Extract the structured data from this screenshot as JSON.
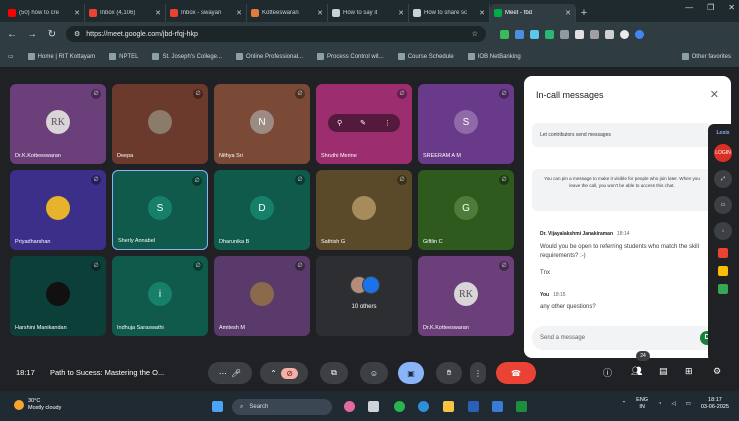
{
  "browser": {
    "tabs": [
      {
        "title": "(50) how to cre",
        "color": "#ff0000",
        "active": false
      },
      {
        "title": "Inbox (4,106)",
        "color": "#ea4335",
        "active": false
      },
      {
        "title": "Inbox - swayan",
        "color": "#ea4335",
        "active": false
      },
      {
        "title": "Kotteeswaran",
        "color": "#e07a3d",
        "active": false
      },
      {
        "title": "How to say it",
        "color": "#c9d1d3",
        "active": false
      },
      {
        "title": "How to share sc",
        "color": "#c9d1d3",
        "active": false
      },
      {
        "title": "Meet - fbd",
        "color": "#00ac47",
        "active": true
      }
    ],
    "url": "https://meet.google.com/jbd-rfqj-hkp",
    "bookmarks": [
      {
        "label": "Home | RIT Kottayam"
      },
      {
        "label": "NPTEL"
      },
      {
        "label": "St. Joseph's College..."
      },
      {
        "label": "Online Professional..."
      },
      {
        "label": "Process Control wit..."
      },
      {
        "label": "Course Schedule"
      },
      {
        "label": "IOB NetBanking"
      }
    ],
    "bookmarks_right": "Other favorites"
  },
  "participants": [
    {
      "name": "Dr.K.Kotteeswaran",
      "initial": "RK",
      "bg": "#6b3f7a",
      "avatar_bg": "#d8d4d8",
      "avatar_fg": "#555"
    },
    {
      "name": "Deepa",
      "initial": "",
      "bg": "#6b3a2c",
      "avatar_bg": "#8a7b6a",
      "avatar_fg": "#fff"
    },
    {
      "name": "Nithya Sri",
      "initial": "N",
      "bg": "#7a4a36",
      "avatar_bg": "#9c8b84",
      "avatar_fg": "#fff"
    },
    {
      "name": "Shruthi Merine",
      "initial": "",
      "bg": "#9c2e6f",
      "avatar_bg": "#9c2e6f",
      "avatar_fg": "#fff"
    },
    {
      "name": "SREERAM A M",
      "initial": "S",
      "bg": "#6a3a8a",
      "avatar_bg": "#8f6aa8",
      "avatar_fg": "#fff"
    },
    {
      "name": "Priyadharshan",
      "initial": "",
      "bg": "#3b2f8a",
      "avatar_bg": "#e6b32a",
      "avatar_fg": "#333"
    },
    {
      "name": "Sherly Annabel",
      "initial": "S",
      "bg": "#0f5a4a",
      "avatar_bg": "#17806a",
      "avatar_fg": "#fff"
    },
    {
      "name": "Dharunika B",
      "initial": "D",
      "bg": "#0f5a4a",
      "avatar_bg": "#17806a",
      "avatar_fg": "#fff"
    },
    {
      "name": "Sathish G",
      "initial": "",
      "bg": "#5a4a2a",
      "avatar_bg": "#a58c5a",
      "avatar_fg": "#fff"
    },
    {
      "name": "Giftlin C",
      "initial": "G",
      "bg": "#2e5a1e",
      "avatar_bg": "#4d7d3a",
      "avatar_fg": "#fff"
    },
    {
      "name": "Harshini Manikandan",
      "initial": "",
      "bg": "#0d3f3a",
      "avatar_bg": "#111",
      "avatar_fg": "#ccc"
    },
    {
      "name": "Indhuja Saraswathi",
      "initial": "i",
      "bg": "#0f5a4a",
      "avatar_bg": "#17806a",
      "avatar_fg": "#fff"
    },
    {
      "name": "Amitesh M",
      "initial": "",
      "bg": "#5a3a6a",
      "avatar_bg": "#8a6a4a",
      "avatar_fg": "#fff"
    },
    {
      "name": "",
      "initial": "",
      "bg": "#2d2e31",
      "avatar_bg": "#2d2e31",
      "avatar_fg": "#fff"
    },
    {
      "name": "Dr.K.Kotteeswaran",
      "initial": "RK",
      "bg": "#6b3f7a",
      "avatar_bg": "#d8d4d8",
      "avatar_fg": "#555"
    }
  ],
  "others_label": "10 others",
  "chat": {
    "title": "In-call messages",
    "toggle_label": "Let contributors send messages",
    "pin_note": "You can pin a message to make it visible for people who join later. When you leave the call, you won't be able to access this chat.",
    "messages": [
      {
        "sender": "Dr. Vijayalakshmi Janakiraman",
        "time": "18:14",
        "lines": [
          "Would you be open to referring students who match the skill requirements? :-)",
          "Tnx"
        ]
      },
      {
        "sender": "You",
        "time": "18:15",
        "lines": [
          "any other questions?"
        ]
      }
    ],
    "input_placeholder": "Send a message"
  },
  "extension": {
    "title": "Loxix",
    "login_label": "LOGIN"
  },
  "controls": {
    "time": "18:17",
    "meeting_title": "Path to Sucess: Mastering the O...",
    "people_count": "24"
  },
  "taskbar": {
    "temperature": "30°C",
    "weather": "Mostly cloudy",
    "search": "Search",
    "lang": "ENG",
    "lang2": "IN",
    "time": "18:17",
    "date": "03-06-2025"
  }
}
